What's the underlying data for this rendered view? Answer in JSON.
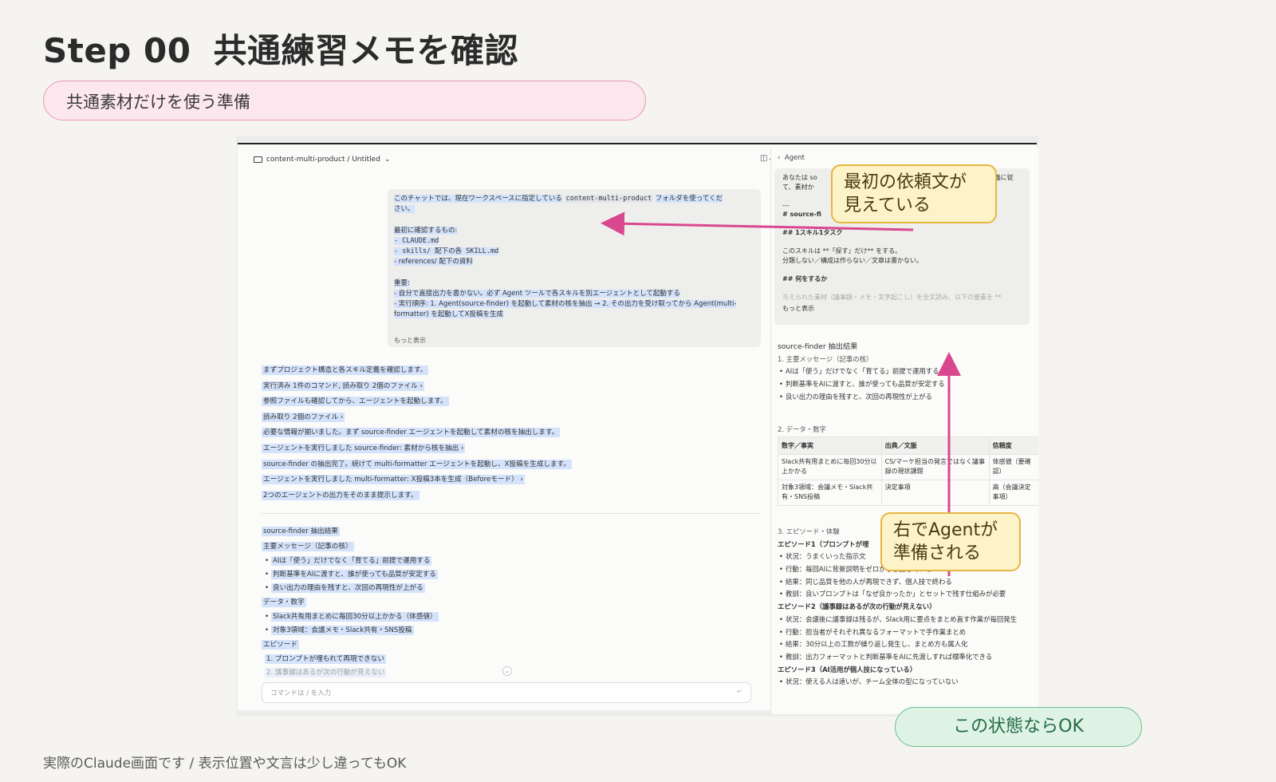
{
  "slide": {
    "title_step": "Step 00",
    "title_text": "共通練習メモを確認",
    "subtitle": "共通素材だけを使う準備",
    "footer": "実際のClaude画面です / 表示位置や文言は少し違ってもOK",
    "ok_label": "この状態ならOK",
    "callout_top_line1": "最初の依頼文が",
    "callout_top_line2": "見えている",
    "callout_right_line1": "右でAgentが",
    "callout_right_line2": "準備される"
  },
  "app": {
    "breadcrumb": "content-multi-product / Untitled",
    "agent_header": "Agent",
    "input_placeholder": "コマンドは / を入力",
    "user_message": {
      "line1a": "このチャットでは、現在ワークスペースに指定している",
      "line1code": "content-multi-product",
      "line1b": "フォルダを使ってくだ",
      "line2": "さい。",
      "line3": "最初に確認するもの:",
      "line4": "- CLAUDE.md",
      "line5": "- skills/ 配下の各 SKILL.md",
      "line6": "- references/ 配下の資料",
      "line7": "重要:",
      "line8": "- 自分で直接出力を書かない。必ず Agent ツールで各スキルを別エージェントとして起動する",
      "line9": "- 実行順序: 1. Agent(source-finder) を起動して素材の核を抽出 → 2. その出力を受け取ってから Agent(multi-",
      "line10": "formatter) を起動してX投稿を生成",
      "show_more": "もっと表示"
    },
    "stream": [
      "まずプロジェクト構造と各スキル定義を確認します。",
      "実行済み 1件のコマンド, 読み取り 2個のファイル ›",
      "参照ファイルも確認してから、エージェントを起動します。",
      "読み取り 2個のファイル ›",
      "必要な情報が揃いました。まず source-finder エージェントを起動して素材の核を抽出します。",
      "エージェントを実行しました source-finder: 素材から核を抽出 ›",
      "source-finder の抽出完了。続けて multi-formatter エージェントを起動し、X投稿を生成します。",
      "エージェントを実行しました multi-formatter: X投稿3本を生成（Beforeモード） ›",
      "2つのエージェントの出力をそのまま提示します。"
    ],
    "result": {
      "heading": "source-finder 抽出結果",
      "sec1": "主要メッセージ（記事の核）",
      "b1": "AIは「使う」だけでなく「育てる」前提で運用する",
      "b2": "判断基準をAIに渡すと、誰が使っても品質が安定する",
      "b3": "良い出力の理由を残すと、次回の再現性が上がる",
      "sec2": "データ・数字",
      "b4": "Slack共有用まとめに毎回30分以上かかる（体感値）",
      "b5": "対象3領域：会議メモ・Slack共有・SNS投稿",
      "sec3": "エピソード",
      "n1": "1. プロンプトが埋もれて再現できない",
      "n2": "2. 議事録はあるが次の行動が見えない"
    },
    "agent_prompt": {
      "l1a": "あなたは so",
      "l1b": "義に従",
      "l2": "て、素材か",
      "l3": "---",
      "l4": "# source-fi",
      "l5": "## 1スキル1タスク",
      "l6": "このスキルは **「探す」だけ** をする。",
      "l7": "分類しない／構成は作らない／文章は書かない。",
      "l8": "## 何をするか",
      "l9": "与えられた素材（議事録・メモ・文字起こし）を全文読み、以下の要素を **",
      "show_more": "もっと表示"
    },
    "agent_result": {
      "heading": "source-finder 抽出結果",
      "sec1": "1. 主要メッセージ（記事の核）",
      "b1": "AIは「使う」だけでなく「育てる」前提で運用する",
      "b2": "判断基準をAIに渡すと、誰が使っても品質が安定する",
      "b3": "良い出力の理由を残すと、次回の再現性が上がる",
      "sec2": "2. データ・数字",
      "table_headers": [
        "数字／事実",
        "出典／文脈",
        "信頼度"
      ],
      "table_rows": [
        [
          "Slack共有用まとめに毎回30分以上かかる",
          "CS/マーケ担当の発言ではなく議事録の現状課題",
          "体感値（要確認）"
        ],
        [
          "対象3領域：会議メモ・Slack共有・SNS投稿",
          "決定事項",
          "高（会議決定事項）"
        ]
      ],
      "sec3": "3. エピソード・体験",
      "ep1": "エピソード1（プロンプトが埋",
      "ep1_b1": "状況：うまくいった指示文",
      "ep1_b2": "行動：毎回AIに背景説明をゼロからし直している",
      "ep1_b3": "結果：同じ品質を他の人が再現できず、個人技で終わる",
      "ep1_b4": "教訓：良いプロンプトは「なぜ良かったか」とセットで残す仕組みが必要",
      "ep2": "エピソード2（議事録はあるが次の行動が見えない）",
      "ep2_b1": "状況：会議後に議事録は残るが、Slack用に要点をまとめ直す作業が毎回発生",
      "ep2_b2": "行動：担当者がそれぞれ異なるフォーマットで手作業まとめ",
      "ep2_b3": "結果：30分以上の工数が繰り返し発生し、まとめ方も属人化",
      "ep2_b4": "教訓：出力フォーマットと判断基準をAIに先渡しすれば標準化できる",
      "ep3": "エピソード3（AI活用が個人技になっている）",
      "ep3_b1": "状況：使える人は速いが、チーム全体の型になっていない"
    }
  },
  "colors": {
    "arrow": "#d9488f",
    "callout_border": "#e7b640",
    "ok_border": "#69c08f",
    "pill_border": "#e89ab8"
  }
}
